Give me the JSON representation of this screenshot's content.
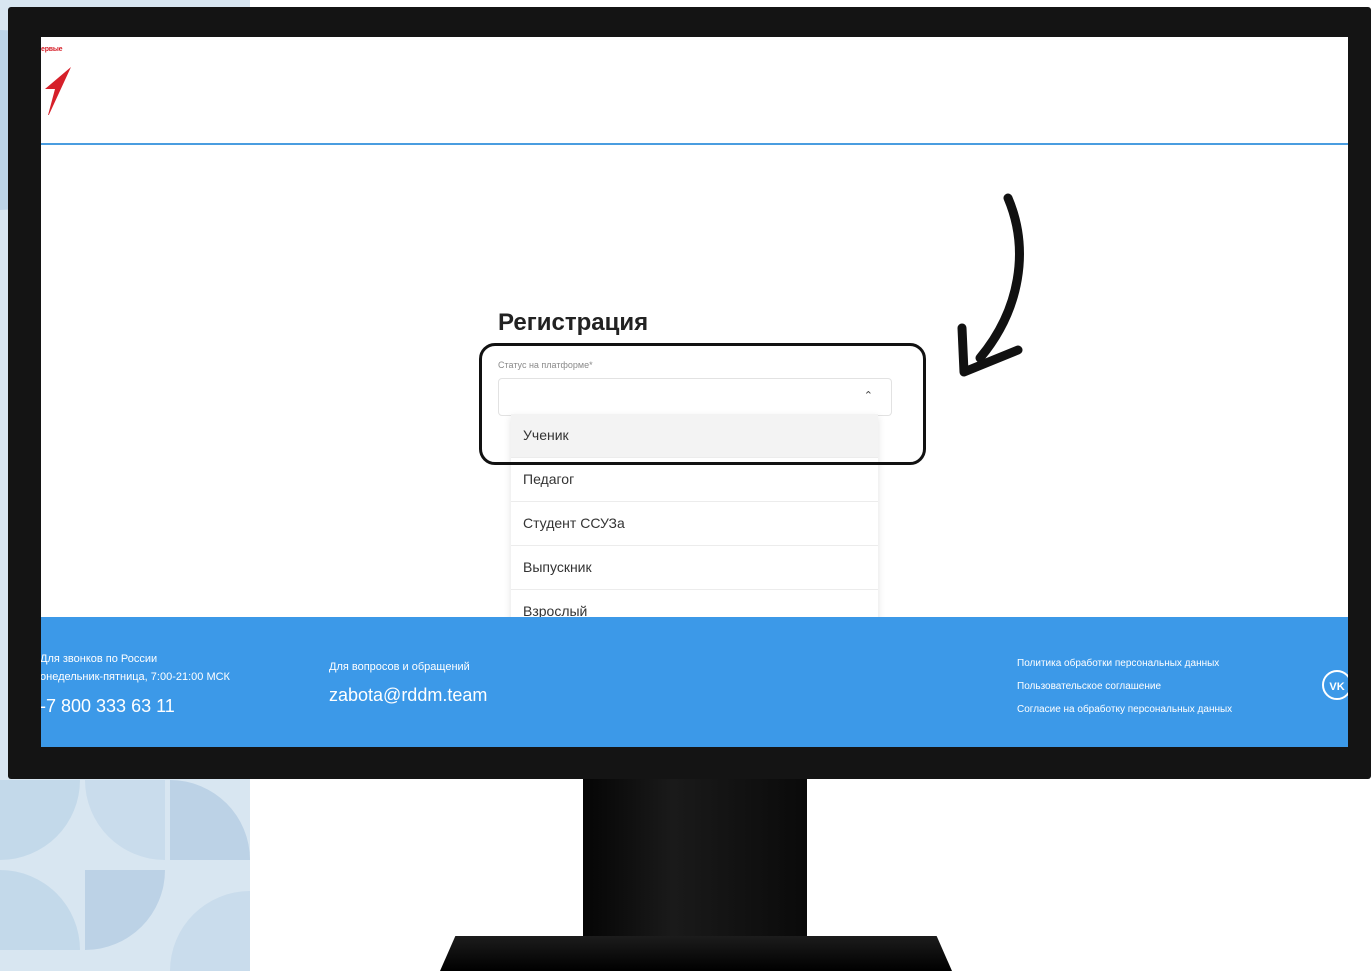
{
  "header": {
    "logo_text": "ервые"
  },
  "registration": {
    "title": "Регистрация",
    "status_label": "Статус на платформе*",
    "status_value": "",
    "dropdown_options": [
      {
        "label": "Ученик",
        "active": true
      },
      {
        "label": "Педагог",
        "active": false
      },
      {
        "label": "Студент ССУЗа",
        "active": false
      },
      {
        "label": "Выпускник",
        "active": false
      },
      {
        "label": "Взрослый",
        "active": false
      }
    ]
  },
  "footer": {
    "call_label": "Для звонков по России",
    "hours": "онедельник-пятница, 7:00-21:00 МСК",
    "phone": "-7 800 333 63 11",
    "questions_label": "Для вопросов и обращений",
    "email": "zabota@rddm.team",
    "links": [
      "Политика обработки персональных данных",
      "Пользовательское соглашение",
      "Согласие на обработку персональных данных"
    ],
    "vk_text": "VK"
  },
  "colors": {
    "footer_bg": "#3c99e8",
    "header_line": "#4a9de0",
    "logo_red": "#d6202a",
    "pattern_blue": "#c7dcec",
    "annotation": "#111111"
  }
}
